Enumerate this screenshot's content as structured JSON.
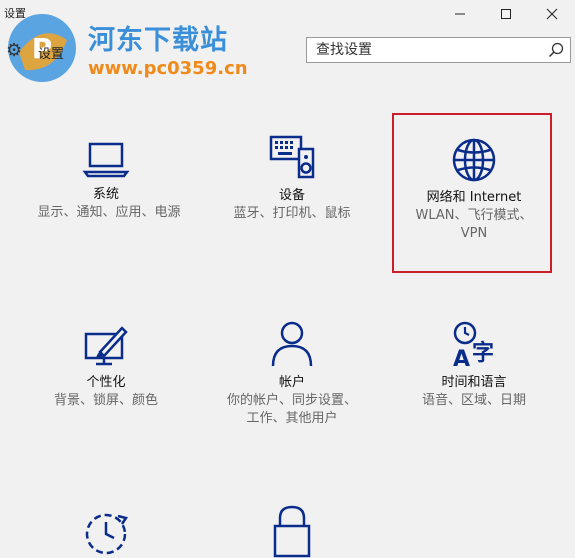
{
  "window": {
    "title": "设置",
    "controls": [
      "minimize-icon",
      "maximize-icon",
      "close-icon"
    ]
  },
  "header": {
    "title": "设置"
  },
  "watermark": {
    "title": "河东下载站",
    "url": "www.pc0359.cn"
  },
  "search": {
    "placeholder": "查找设置",
    "icon": "search-icon"
  },
  "tiles": [
    {
      "title": "系统",
      "desc": "显示、通知、应用、电源",
      "icon": "laptop-icon"
    },
    {
      "title": "设备",
      "desc": "蓝牙、打印机、鼠标",
      "icon": "devices-icon"
    },
    {
      "title": "网络和 Internet",
      "desc": "WLAN、飞行模式、VPN",
      "icon": "globe-icon"
    },
    {
      "title": "个性化",
      "desc": "背景、锁屏、颜色",
      "icon": "personalization-icon"
    },
    {
      "title": "帐户",
      "desc": "你的帐户、同步设置、工作、其他用户",
      "icon": "person-icon"
    },
    {
      "title": "时间和语言",
      "desc": "语音、区域、日期",
      "icon": "time-language-icon"
    },
    {
      "title": "",
      "desc": "",
      "icon": "update-icon"
    },
    {
      "title": "",
      "desc": "",
      "icon": "lock-icon"
    }
  ],
  "colors": {
    "accent": "#0a2c8a",
    "highlight": "#cc1e28",
    "background": "#f1f1f1"
  }
}
